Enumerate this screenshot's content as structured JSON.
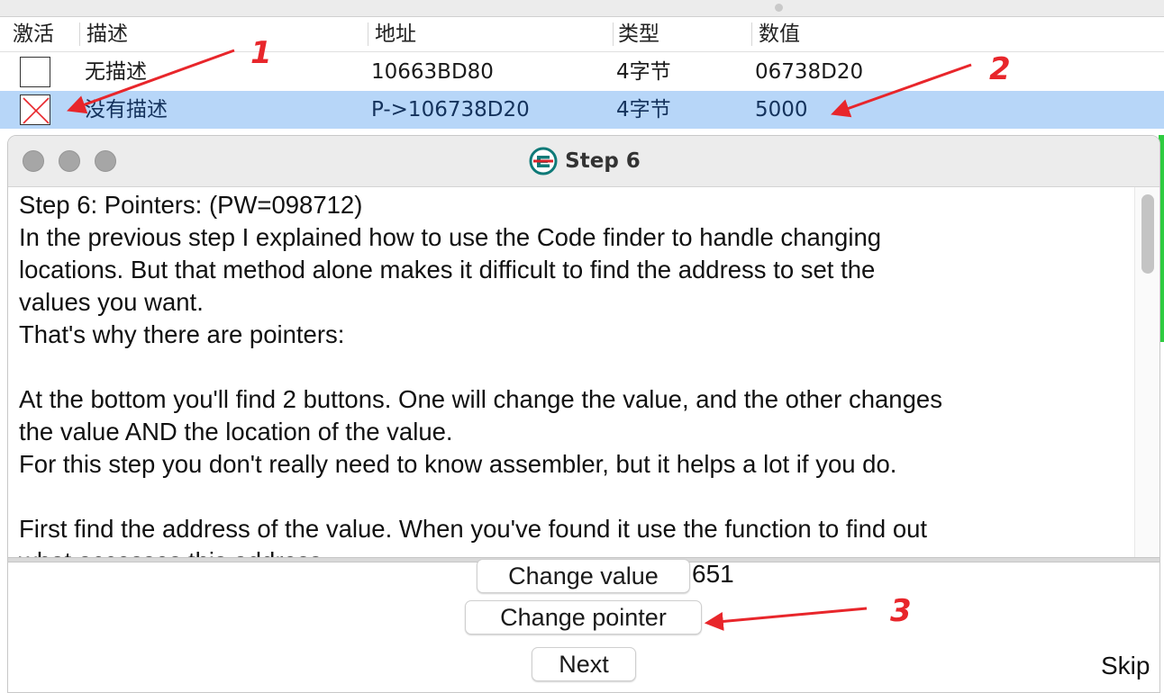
{
  "table": {
    "headers": [
      "激活",
      "描述",
      "地址",
      "类型",
      "数值"
    ],
    "rows": [
      {
        "active": false,
        "description": "无描述",
        "address": "10663BD80",
        "type": "4字节",
        "value": "06738D20",
        "selected": false
      },
      {
        "active": true,
        "description": "没有描述",
        "address": "P->106738D20",
        "type": "4字节",
        "value": "5000",
        "selected": true
      }
    ]
  },
  "dialog": {
    "title": "Step 6",
    "body_lines": [
      "Step 6: Pointers: (PW=098712)",
      "In the previous step I explained how to use the Code finder to handle changing",
      "locations. But that method alone makes it difficult to find the address to set the",
      "values you want.",
      "That's why there are pointers:",
      "",
      "At the bottom you'll find 2 buttons. One will change the value, and the other changes",
      "the value AND the location of the value.",
      "For this step you don't really need to know assembler, but it helps a lot if you do.",
      "",
      "First find the address of the value. When you've found it use the function to find out",
      "what accesses this address."
    ],
    "buttons": {
      "change_value": "Change value",
      "change_pointer": "Change pointer",
      "next": "Next"
    },
    "current_value": "651",
    "skip": "Skip"
  },
  "annotations": {
    "labels": [
      "1",
      "2",
      "3"
    ],
    "color": "#e8262b"
  },
  "colors": {
    "selected_row": "#b7d6f8",
    "titlebar": "#ececec",
    "checkbox_mark": "#e8262b"
  }
}
